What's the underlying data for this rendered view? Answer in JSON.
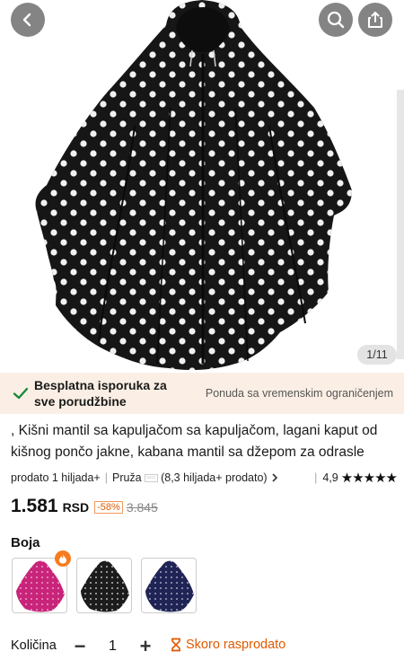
{
  "hero": {
    "image_counter": "1/11",
    "back_icon": "chevron-left-icon",
    "search_icon": "search-icon",
    "share_icon": "share-icon"
  },
  "shipping": {
    "free_shipping": "Besplatna isporuka za sve porudžbine",
    "limited_offer": "Ponuda sa vremenskim ograničenjem"
  },
  "product": {
    "title": ", Kišni mantil sa kapuljačom sa kapuljačom, lagani kaput od kišnog pončo jakne, kabana mantil sa džepom za odrasle",
    "sold": "prodato 1 hiljada+",
    "seller_prefix": "Pruža",
    "seller_sold": "(8,3 hiljada+ prodato)",
    "rating": "4,9",
    "stars": "★★★★★"
  },
  "price": {
    "current": "1.581",
    "currency": "RSD",
    "discount": "-58%",
    "original": "3.845"
  },
  "color": {
    "label": "Boja",
    "options": [
      {
        "name": "pink",
        "color": "#c8247a"
      },
      {
        "name": "black",
        "color": "#1c1c1c"
      },
      {
        "name": "navy",
        "color": "#1f2454"
      }
    ]
  },
  "quantity": {
    "label": "Količina",
    "value": "1",
    "minus": "−",
    "plus": "+"
  },
  "stock": {
    "label": "Skoro rasprodato"
  },
  "colors": {
    "accent": "#e05a00",
    "banner_bg": "#fbefe5",
    "check_green": "#1a8a3a"
  }
}
